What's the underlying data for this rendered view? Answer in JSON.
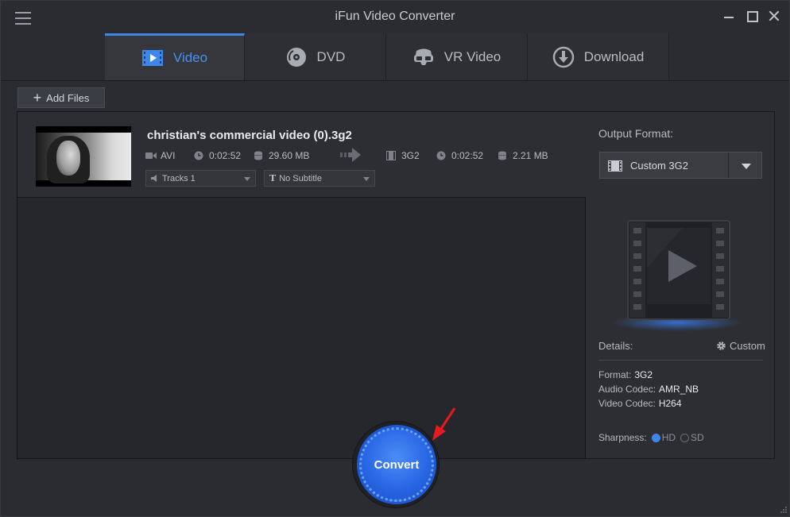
{
  "app": {
    "title": "iFun Video Converter"
  },
  "tabs": [
    {
      "label": "Video",
      "icon": "video-play-icon",
      "active": true
    },
    {
      "label": "DVD",
      "icon": "dvd-disc-icon",
      "active": false
    },
    {
      "label": "VR Video",
      "icon": "vr-headset-icon",
      "active": false
    },
    {
      "label": "Download",
      "icon": "download-icon",
      "active": false
    }
  ],
  "toolbar": {
    "add_files_label": "Add Files"
  },
  "file": {
    "name": "christian's commercial video (0).3g2",
    "source": {
      "format": "AVI",
      "duration": "0:02:52",
      "size": "29.60 MB"
    },
    "target": {
      "format": "3G2",
      "duration": "0:02:52",
      "size": "2.21 MB"
    },
    "tracks_label": "Tracks 1",
    "subtitle_label": "No Subtitle"
  },
  "output": {
    "label": "Output Format:",
    "selected": "Custom 3G2",
    "details_label": "Details:",
    "custom_label": "Custom",
    "format_key": "Format:",
    "format_value": "3G2",
    "audio_key": "Audio Codec:",
    "audio_value": "AMR_NB",
    "video_key": "Video Codec:",
    "video_value": "H264",
    "sharpness_label": "Sharpness:",
    "sharpness_hd": "HD",
    "sharpness_sd": "SD",
    "sharpness_selected": "HD"
  },
  "convert": {
    "label": "Convert"
  },
  "colors": {
    "accent": "#3f86ea",
    "annotation_arrow": "#e8191f"
  }
}
